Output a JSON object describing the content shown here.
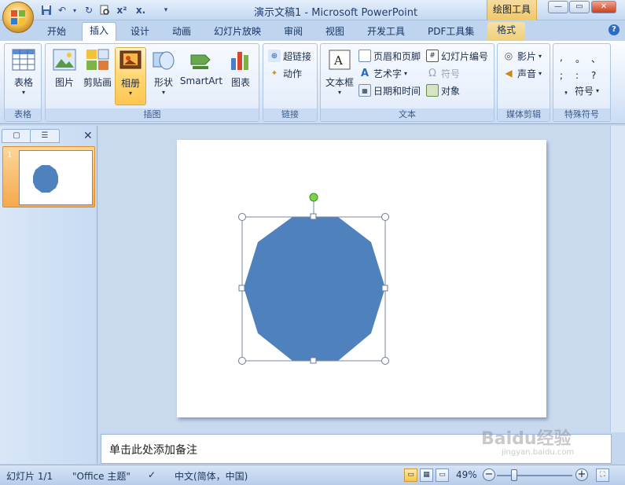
{
  "titlebar": {
    "title": "演示文稿1 - Microsoft PowerPoint",
    "context_tab_title": "绘图工具",
    "quick_access": [
      "save-icon",
      "undo-icon",
      "redo-icon",
      "print-preview-icon",
      "superscript-icon",
      "subscript-icon",
      "customize-dropdown-icon"
    ]
  },
  "tabs": [
    {
      "label": "开始"
    },
    {
      "label": "插入",
      "active": true
    },
    {
      "label": "设计"
    },
    {
      "label": "动画"
    },
    {
      "label": "幻灯片放映"
    },
    {
      "label": "审阅"
    },
    {
      "label": "视图"
    },
    {
      "label": "开发工具"
    },
    {
      "label": "PDF工具集"
    },
    {
      "label": "格式"
    }
  ],
  "ribbon": {
    "groups": {
      "table": {
        "label": "表格",
        "buttons": [
          "表格"
        ]
      },
      "illustrations": {
        "label": "插图",
        "buttons": [
          "图片",
          "剪贴画",
          "相册",
          "形状",
          "SmartArt",
          "图表"
        ]
      },
      "links": {
        "label": "链接",
        "buttons": [
          "超链接",
          "动作"
        ]
      },
      "text": {
        "label": "文本",
        "big": "文本框",
        "col1": [
          "页眉和页脚",
          "艺术字",
          "日期和时间"
        ],
        "col2": [
          "幻灯片编号",
          "符号",
          "对象"
        ]
      },
      "media": {
        "label": "媒体剪辑",
        "buttons": [
          "影片",
          "声音"
        ]
      },
      "special": {
        "label": "特殊符号",
        "symbols": [
          ",",
          "。",
          "、",
          ";",
          ":",
          "?"
        ],
        "button": "符号"
      }
    }
  },
  "slides_panel": {
    "thumb_number": "1"
  },
  "notes": {
    "placeholder": "单击此处添加备注"
  },
  "status": {
    "slide": "幻灯片 1/1",
    "theme": "\"Office 主题\"",
    "language": "中文(简体，中国)",
    "zoom": "49%",
    "zoom_fraction": 0.49
  },
  "colors": {
    "shape_fill": "#4f81bd",
    "active_button": "#ffd771"
  },
  "watermark": {
    "text": "Baidu经验",
    "sub": "jingyan.baidu.com"
  }
}
